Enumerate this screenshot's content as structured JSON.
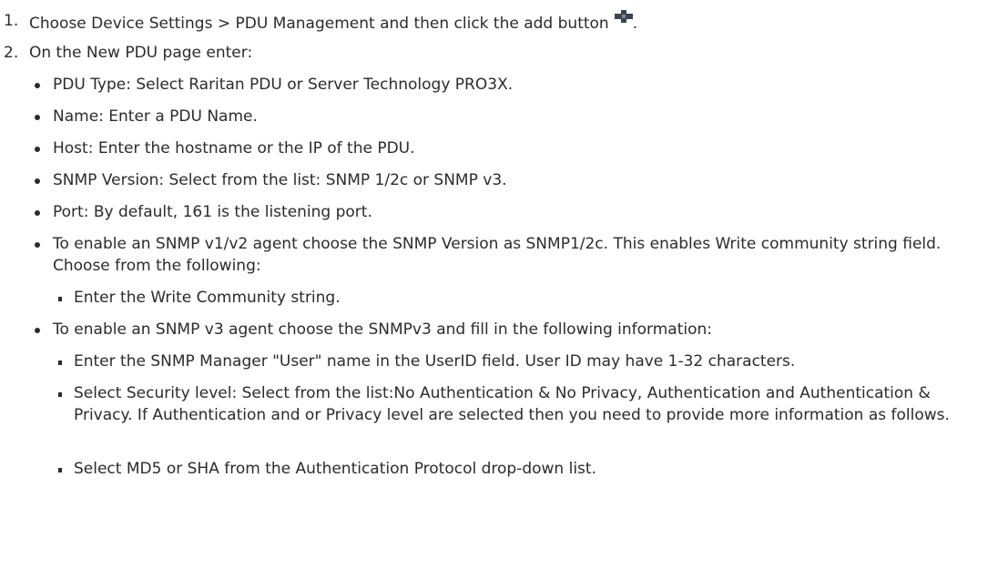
{
  "steps": [
    {
      "number": "1.",
      "text": "Choose Device Settings > PDU Management and then click the add button",
      "suffix": "."
    },
    {
      "number": "2.",
      "text": "On the New PDU page enter:"
    }
  ],
  "icons": {
    "add_button": "plus-icon"
  },
  "bullets": [
    {
      "text": "PDU Type: Select Raritan PDU or Server Technology PRO3X."
    },
    {
      "text": "Name: Enter a PDU Name."
    },
    {
      "text": "Host: Enter the hostname or the IP of the PDU."
    },
    {
      "text": "SNMP Version: Select from the list: SNMP 1/2c or SNMP v3."
    },
    {
      "text": "Port: By default, 161 is the listening port."
    },
    {
      "text": "To enable an SNMP v1/v2 agent choose the SNMP Version as SNMP1/2c. This enables Write community string field. Choose from the following:"
    },
    {
      "text": "To enable an SNMP v3 agent choose the SNMPv3 and fill in the following information:"
    }
  ],
  "sub_v1": [
    {
      "text": "Enter the Write Community string."
    }
  ],
  "sub_v3": [
    {
      "text": "Enter the SNMP Manager \"User\" name in the UserID field. User ID may have 1-32 characters."
    },
    {
      "text": "Select Security level: Select from the list:No Authentication & No Privacy, Authentication and Authentication & Privacy. If Authentication and or Privacy level are selected then you need to provide more information as follows."
    },
    {
      "text": "Select MD5 or SHA from the Authentication Protocol drop-down list."
    }
  ],
  "colors": {
    "text": "#2b2b2b",
    "icon_dark": "#3a4650"
  }
}
